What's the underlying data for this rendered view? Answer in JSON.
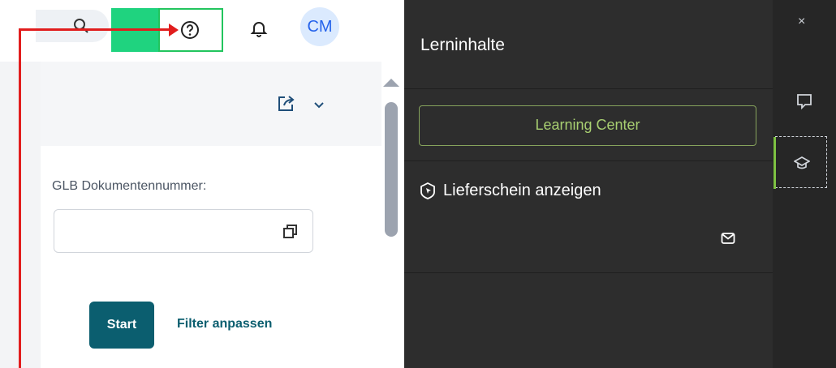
{
  "header": {
    "search_icon": "search-icon",
    "help_icon": "help-circle-icon",
    "notifications_icon": "bell-icon",
    "avatar_initials": "CM"
  },
  "toolbar": {
    "share_icon": "share-icon",
    "menu_icon": "chevron-down-icon"
  },
  "form": {
    "doc_number_label": "GLB Dokumentennummer:",
    "doc_number_value": "",
    "value_help_icon": "value-help-icon",
    "start_label": "Start",
    "filter_label": "Filter anpassen"
  },
  "panel": {
    "title": "Lerninhalte",
    "learning_center_label": "Learning Center",
    "item_label": "Lieferschein anzeigen",
    "item_icon": "cursor-badge-icon",
    "mail_icon": "mail-icon"
  },
  "rail": {
    "close_label": "×",
    "chat_icon": "chat-icon",
    "learning_icon": "graduation-cap-icon"
  },
  "colors": {
    "accent_green": "#22c55e",
    "highlight_block": "#1fd37f",
    "annotation_red": "#e11d1d",
    "start_button": "#0b5e6f",
    "learning_center_text": "#a8cf71"
  }
}
